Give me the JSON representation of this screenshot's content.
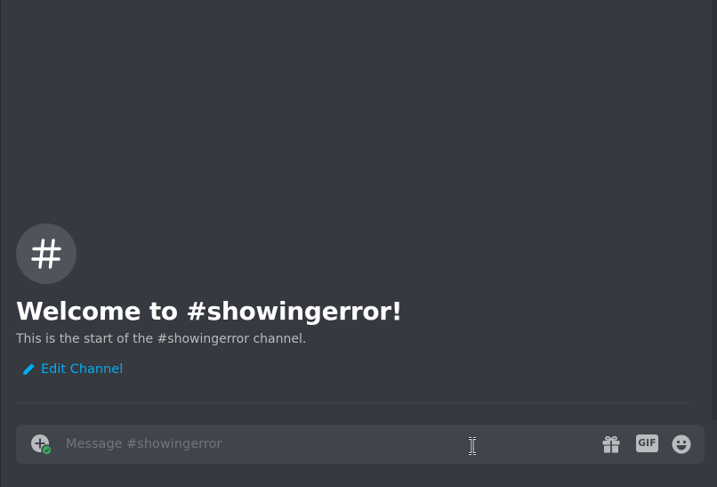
{
  "channel": {
    "name": "showingerror",
    "avatar_glyph": "#",
    "welcome_title": "Welcome to #showingerror!",
    "welcome_subtitle": "This is the start of the #showingerror channel.",
    "edit_label": "Edit Channel"
  },
  "composer": {
    "placeholder": "Message #showingerror",
    "value": "",
    "gif_label": "GIF",
    "icons": {
      "attach": "plus-circle-icon",
      "gift": "gift-icon",
      "gif": "gif-icon",
      "emoji": "smiley-icon",
      "pencil": "pencil-icon",
      "cursor": "text-cursor-icon"
    }
  },
  "colors": {
    "background": "#36393f",
    "composer_bg": "#40444b",
    "avatar_bg": "#4f545c",
    "link": "#00aff4",
    "muted_text": "#b9bbbe",
    "placeholder": "#72767d",
    "online_green": "#3ba55c"
  }
}
